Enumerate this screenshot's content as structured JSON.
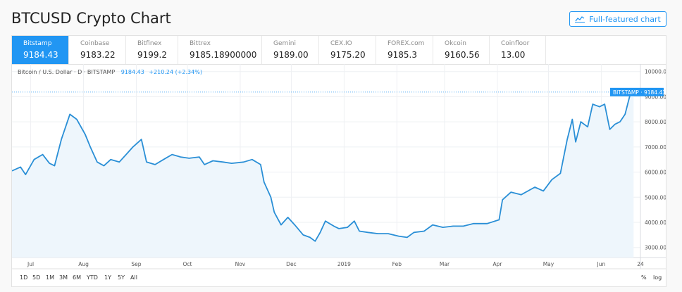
{
  "page": {
    "title": "BTCUSD Crypto Chart",
    "full_btn": "Full-featured chart"
  },
  "tabs": [
    {
      "name": "Bitstamp",
      "value": "9184.43"
    },
    {
      "name": "Coinbase",
      "value": "9183.22"
    },
    {
      "name": "Bitfinex",
      "value": "9199.2"
    },
    {
      "name": "Bittrex",
      "value": "9185.18900000"
    },
    {
      "name": "Gemini",
      "value": "9189.00"
    },
    {
      "name": "CEX.IO",
      "value": "9175.20"
    },
    {
      "name": "FOREX.com",
      "value": "9185.3"
    },
    {
      "name": "Okcoin",
      "value": "9160.56"
    },
    {
      "name": "Coinfloor",
      "value": "13.00"
    }
  ],
  "legend": {
    "symbol": "Bitcoin / U.S. Dollar · D · BITSTAMP",
    "value": "9184.43",
    "change": "+210.24 (+2.34%)"
  },
  "price_tag": {
    "label": "BITSTAMP",
    "value": "9184.43"
  },
  "timeframes": [
    "1D",
    "5D",
    "1M",
    "3M",
    "6M",
    "YTD",
    "1Y",
    "5Y",
    "All"
  ],
  "scale_opts": {
    "percent": "%",
    "log": "log"
  },
  "colors": {
    "accent": "#2196f3",
    "line": "#2a8fd6",
    "area": "#eef6fc"
  },
  "chart_data": {
    "type": "area",
    "title": "",
    "xlabel": "",
    "ylabel": "",
    "ylim": [
      2600,
      10300
    ],
    "x_range": [
      "2018-06-20",
      "2019-06-24"
    ],
    "yticks": [
      "10000.00",
      "9000.00",
      "8000.00",
      "7000.00",
      "6000.00",
      "5000.00",
      "4000.00",
      "3000.00"
    ],
    "xticks": [
      {
        "label": "Jul",
        "date": "2018-07-01"
      },
      {
        "label": "Aug",
        "date": "2018-08-01"
      },
      {
        "label": "Sep",
        "date": "2018-09-01"
      },
      {
        "label": "Oct",
        "date": "2018-10-01"
      },
      {
        "label": "Nov",
        "date": "2018-11-01"
      },
      {
        "label": "Dec",
        "date": "2018-12-01"
      },
      {
        "label": "2019",
        "date": "2019-01-01"
      },
      {
        "label": "Feb",
        "date": "2019-02-01"
      },
      {
        "label": "Mar",
        "date": "2019-03-01"
      },
      {
        "label": "Apr",
        "date": "2019-04-01"
      },
      {
        "label": "May",
        "date": "2019-05-01"
      },
      {
        "label": "Jun",
        "date": "2019-06-01"
      },
      {
        "label": "24",
        "date": "2019-06-24"
      }
    ],
    "grid": true,
    "series": [
      {
        "points": [
          [
            "2018-06-20",
            6050
          ],
          [
            "2018-06-25",
            6200
          ],
          [
            "2018-06-28",
            5900
          ],
          [
            "2018-07-03",
            6500
          ],
          [
            "2018-07-08",
            6700
          ],
          [
            "2018-07-12",
            6350
          ],
          [
            "2018-07-15",
            6250
          ],
          [
            "2018-07-19",
            7300
          ],
          [
            "2018-07-24",
            8300
          ],
          [
            "2018-07-28",
            8100
          ],
          [
            "2018-08-02",
            7500
          ],
          [
            "2018-08-05",
            7000
          ],
          [
            "2018-08-09",
            6400
          ],
          [
            "2018-08-13",
            6250
          ],
          [
            "2018-08-17",
            6500
          ],
          [
            "2018-08-22",
            6400
          ],
          [
            "2018-08-26",
            6700
          ],
          [
            "2018-08-30",
            7000
          ],
          [
            "2018-09-04",
            7300
          ],
          [
            "2018-09-07",
            6400
          ],
          [
            "2018-09-12",
            6300
          ],
          [
            "2018-09-17",
            6500
          ],
          [
            "2018-09-22",
            6700
          ],
          [
            "2018-09-27",
            6600
          ],
          [
            "2018-10-02",
            6550
          ],
          [
            "2018-10-08",
            6600
          ],
          [
            "2018-10-11",
            6300
          ],
          [
            "2018-10-16",
            6450
          ],
          [
            "2018-10-22",
            6400
          ],
          [
            "2018-10-27",
            6350
          ],
          [
            "2018-11-03",
            6400
          ],
          [
            "2018-11-08",
            6500
          ],
          [
            "2018-11-13",
            6300
          ],
          [
            "2018-11-15",
            5600
          ],
          [
            "2018-11-19",
            5000
          ],
          [
            "2018-11-21",
            4400
          ],
          [
            "2018-11-25",
            3900
          ],
          [
            "2018-11-29",
            4200
          ],
          [
            "2018-12-03",
            3900
          ],
          [
            "2018-12-08",
            3500
          ],
          [
            "2018-12-12",
            3400
          ],
          [
            "2018-12-15",
            3250
          ],
          [
            "2018-12-18",
            3600
          ],
          [
            "2018-12-21",
            4050
          ],
          [
            "2018-12-26",
            3850
          ],
          [
            "2018-12-29",
            3750
          ],
          [
            "2019-01-03",
            3800
          ],
          [
            "2019-01-07",
            4050
          ],
          [
            "2019-01-10",
            3650
          ],
          [
            "2019-01-15",
            3600
          ],
          [
            "2019-01-21",
            3550
          ],
          [
            "2019-01-27",
            3550
          ],
          [
            "2019-02-02",
            3450
          ],
          [
            "2019-02-07",
            3400
          ],
          [
            "2019-02-11",
            3600
          ],
          [
            "2019-02-17",
            3650
          ],
          [
            "2019-02-22",
            3900
          ],
          [
            "2019-02-28",
            3800
          ],
          [
            "2019-03-06",
            3850
          ],
          [
            "2019-03-12",
            3850
          ],
          [
            "2019-03-18",
            3950
          ],
          [
            "2019-03-26",
            3950
          ],
          [
            "2019-04-02",
            4100
          ],
          [
            "2019-04-04",
            4900
          ],
          [
            "2019-04-09",
            5200
          ],
          [
            "2019-04-15",
            5100
          ],
          [
            "2019-04-23",
            5400
          ],
          [
            "2019-04-28",
            5250
          ],
          [
            "2019-05-03",
            5700
          ],
          [
            "2019-05-08",
            5950
          ],
          [
            "2019-05-12",
            7300
          ],
          [
            "2019-05-15",
            8100
          ],
          [
            "2019-05-17",
            7200
          ],
          [
            "2019-05-20",
            8000
          ],
          [
            "2019-05-24",
            7800
          ],
          [
            "2019-05-27",
            8700
          ],
          [
            "2019-05-31",
            8600
          ],
          [
            "2019-06-03",
            8700
          ],
          [
            "2019-06-06",
            7700
          ],
          [
            "2019-06-09",
            7900
          ],
          [
            "2019-06-12",
            8000
          ],
          [
            "2019-06-15",
            8300
          ],
          [
            "2019-06-18",
            9100
          ],
          [
            "2019-06-20",
            9184.43
          ]
        ]
      }
    ]
  }
}
